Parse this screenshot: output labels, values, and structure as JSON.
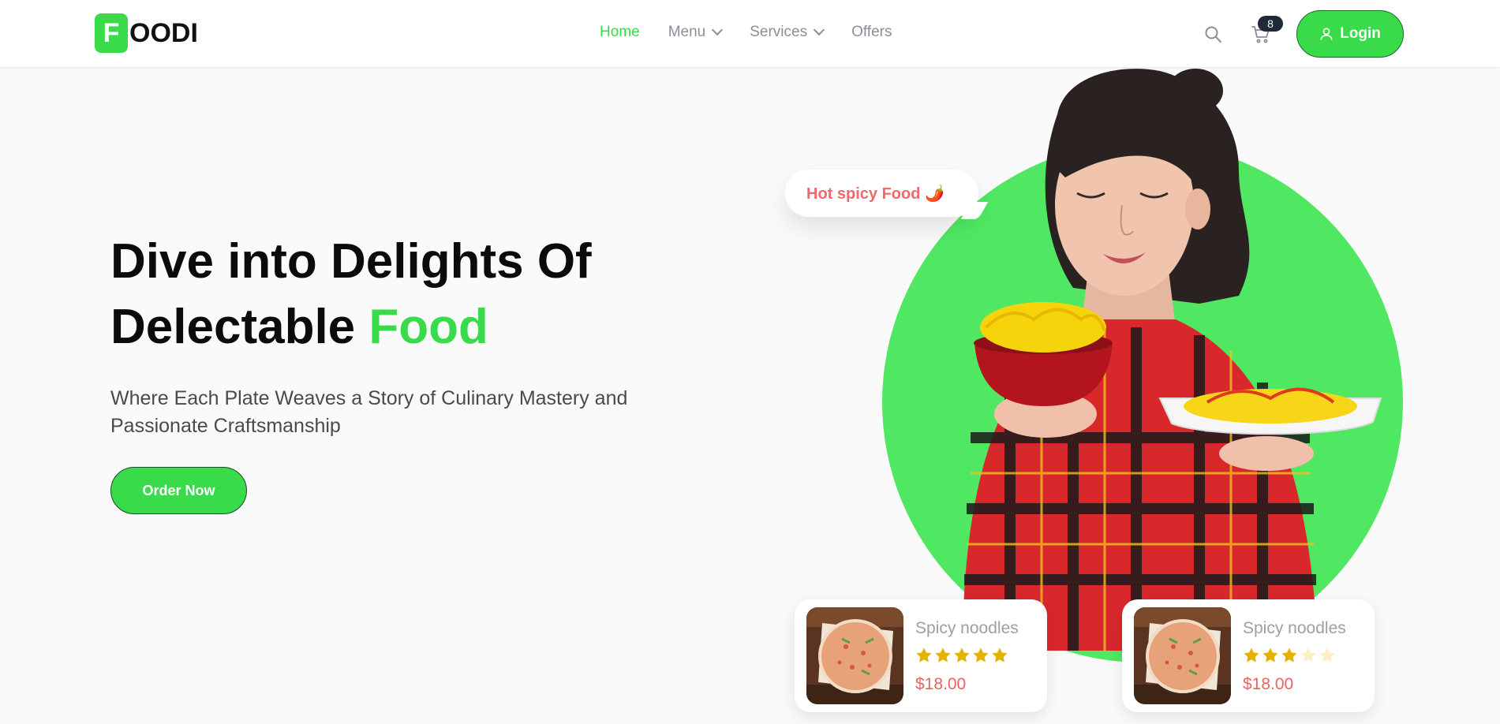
{
  "logo": {
    "letter": "F",
    "text": "OODI"
  },
  "nav": {
    "items": [
      {
        "label": "Home",
        "active": true,
        "dropdown": false
      },
      {
        "label": "Menu",
        "active": false,
        "dropdown": true
      },
      {
        "label": "Services",
        "active": false,
        "dropdown": true
      },
      {
        "label": "Offers",
        "active": false,
        "dropdown": false
      }
    ]
  },
  "header": {
    "cart_count": "8",
    "login_label": "Login"
  },
  "hero": {
    "title_line1": "Dive into Delights Of",
    "title_line2_prefix": "Delectable ",
    "title_line2_accent": "Food",
    "subtitle": "Where Each Plate Weaves a Story of Culinary Mastery and Passionate Craftsmanship",
    "cta_label": "Order Now",
    "bubble_text": "Hot spicy Food 🌶️"
  },
  "cards": [
    {
      "name": "Spicy noodles",
      "rating": 5,
      "max_rating": 5,
      "price": "$18.00"
    },
    {
      "name": "Spicy noodles",
      "rating": 3,
      "max_rating": 5,
      "price": "$18.00"
    }
  ],
  "colors": {
    "accent": "#39db4a",
    "circle": "#50e862",
    "price": "#e86464",
    "star_filled": "#e5b100",
    "star_empty": "#fbefc4"
  }
}
